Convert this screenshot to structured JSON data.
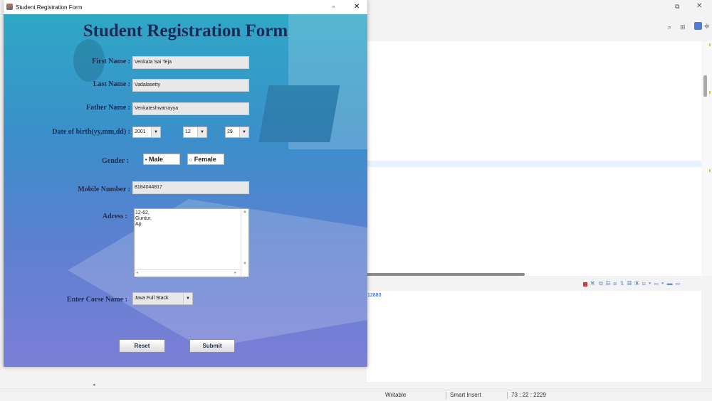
{
  "window": {
    "title": "Student Registration Form",
    "minimize_glyph": "▫",
    "close_glyph": "✕"
  },
  "form": {
    "heading": "Student Registration Form",
    "first_name_label": "First Name :",
    "first_name_value": "Venkata Sai Teja",
    "last_name_label": "Last Name :",
    "last_name_value": "Vadalasetty",
    "father_name_label": "Father Name :",
    "father_name_value": "Venkateshwarrayya",
    "dob_label": "Date of birth(yy,mm,dd) :",
    "dob_year": "2001",
    "dob_month": "12",
    "dob_day": "29",
    "gender_label": "Gender :",
    "gender_male": "Male",
    "gender_female": "Female",
    "mobile_label": "Mobile Number :",
    "mobile_value": "8184044817",
    "address_label": "Adress :",
    "address_lines": [
      "12-62,",
      "Guntur,",
      "Ap."
    ],
    "course_label": "Enter Corse Name :",
    "course_value": "Java Full Stack",
    "reset_label": "Reset",
    "submit_label": "Submit"
  },
  "ide": {
    "console_text": "12880",
    "status_writable": "Writable",
    "status_insert": "Smart Insert",
    "status_position": "73 : 22 : 2229"
  }
}
